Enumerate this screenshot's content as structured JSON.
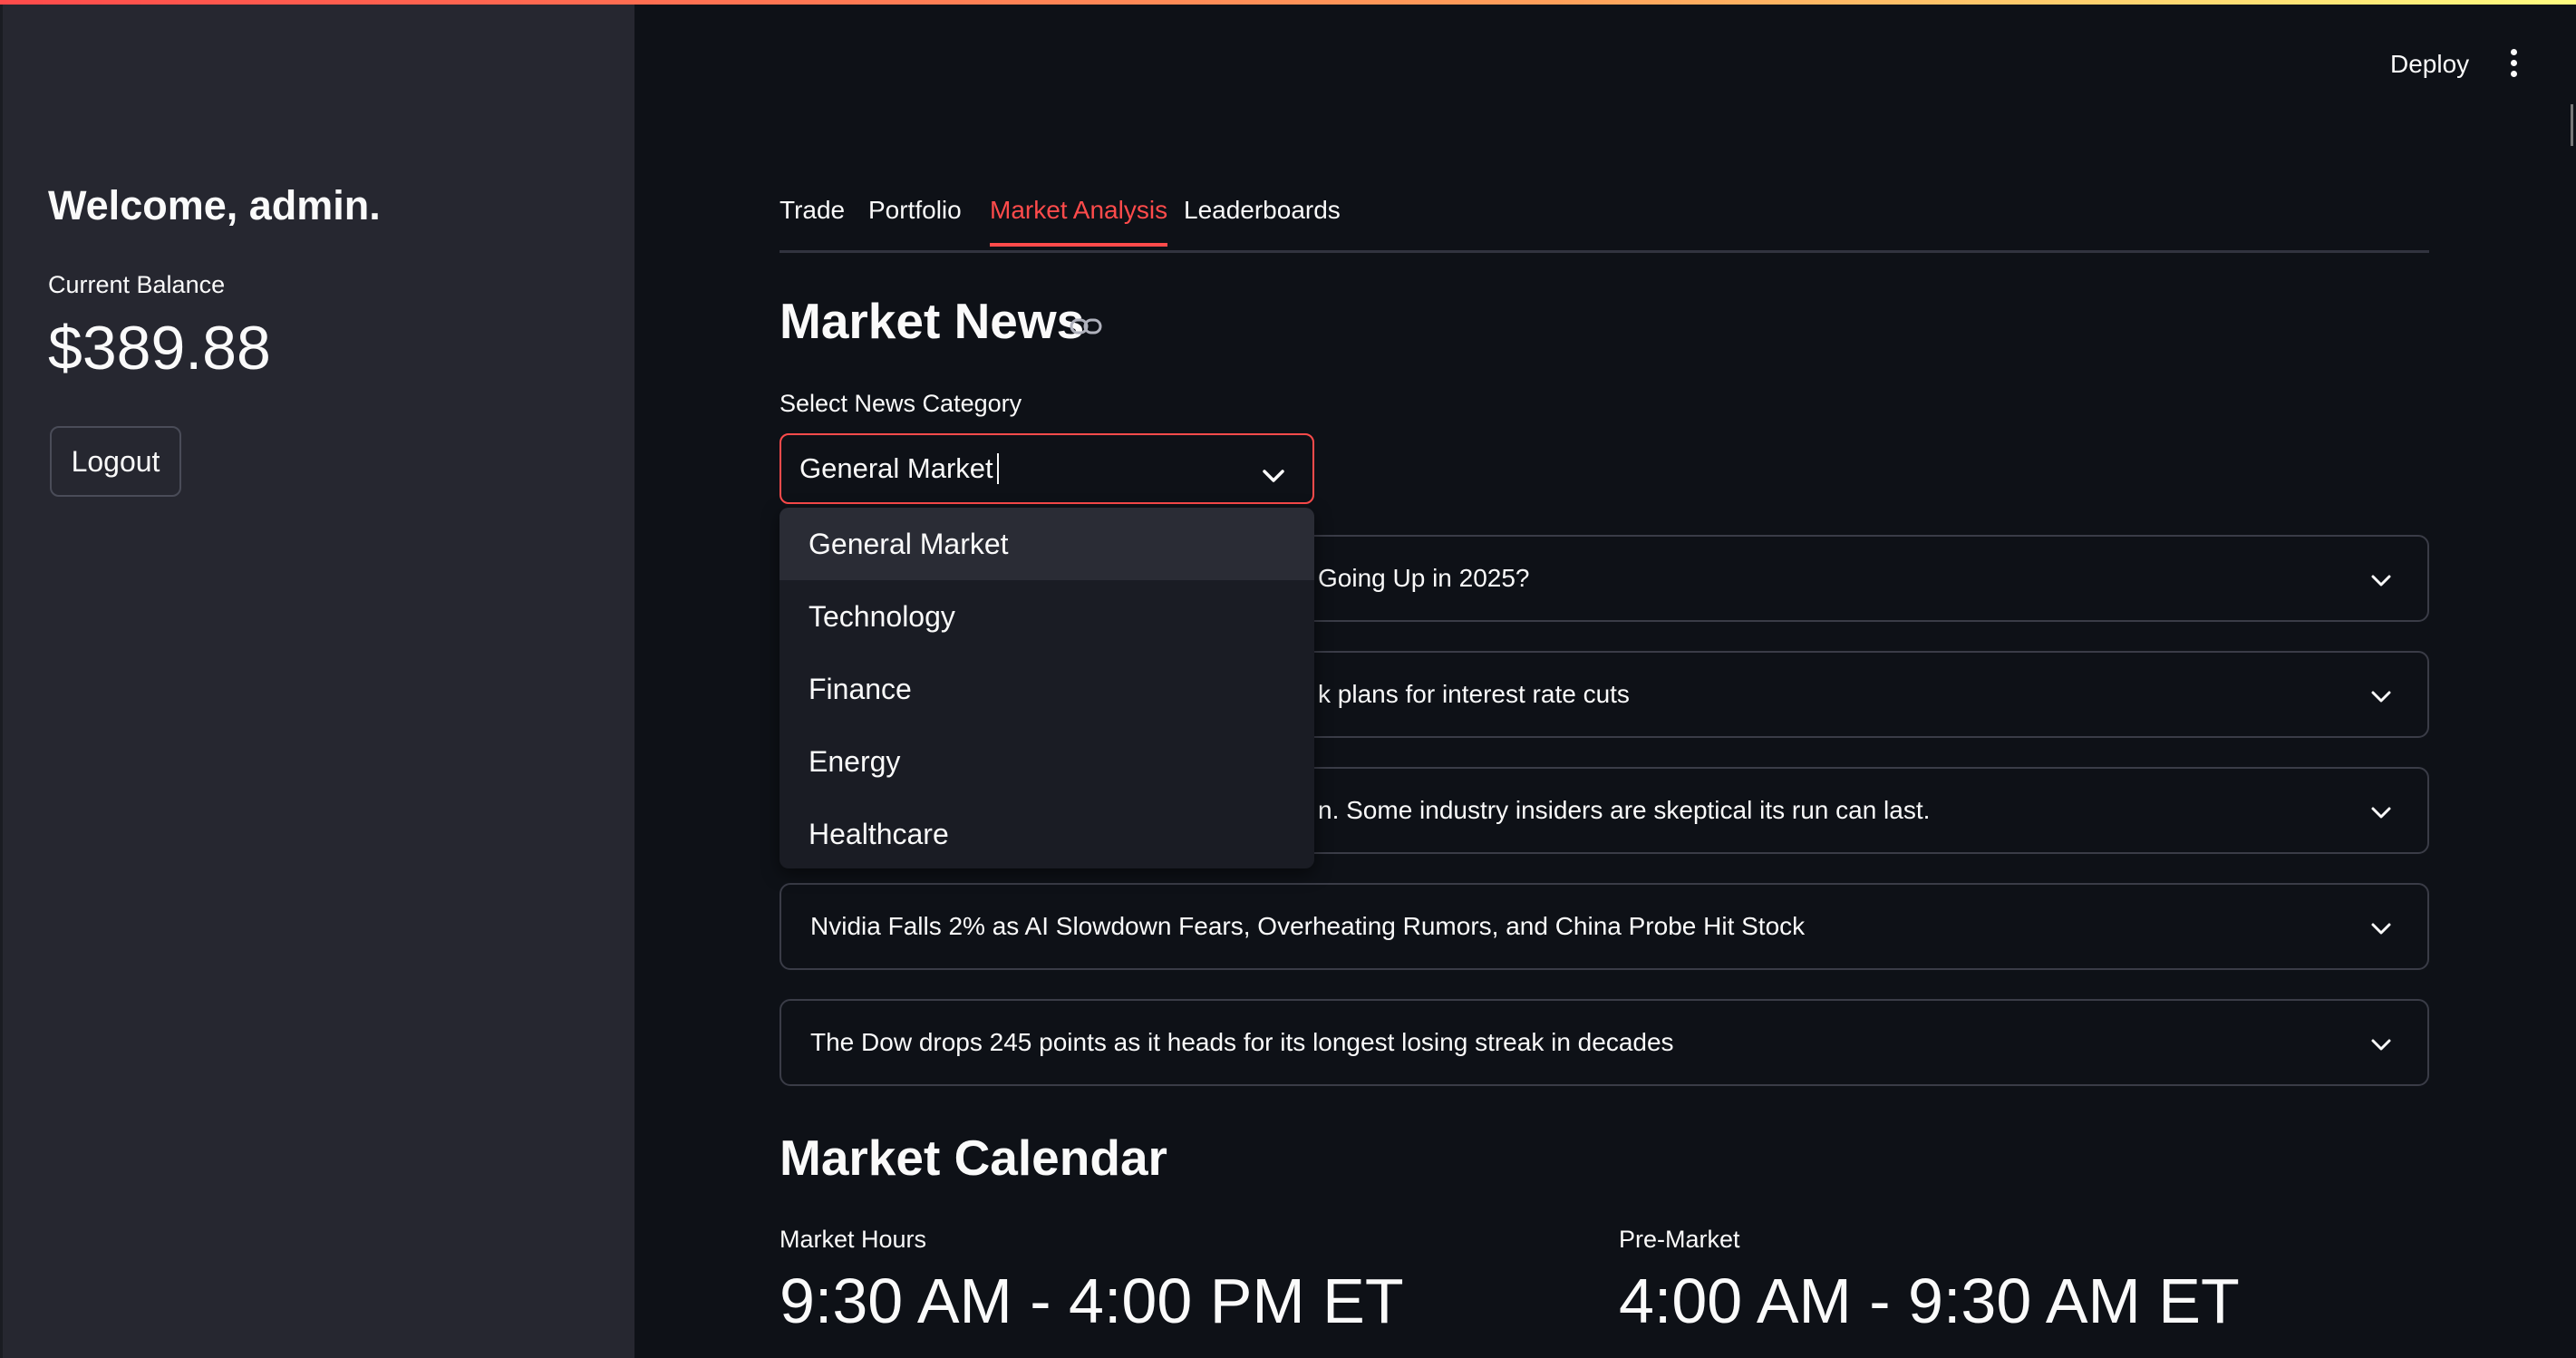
{
  "sidebar": {
    "welcome": "Welcome, admin.",
    "balance_label": "Current Balance",
    "balance_value": "$389.88",
    "logout_label": "Logout"
  },
  "header": {
    "deploy_label": "Deploy",
    "menu_icon": "kebab-menu-icon"
  },
  "tabs": [
    {
      "label": "Trade",
      "active": false
    },
    {
      "label": "Portfolio",
      "active": false
    },
    {
      "label": "Market Analysis",
      "active": true
    },
    {
      "label": "Leaderboards",
      "active": false
    }
  ],
  "news": {
    "heading": "Market News",
    "heading_icon": "link-icon",
    "select_label": "Select News Category",
    "select_value": "General Market",
    "options": [
      "General Market",
      "Technology",
      "Finance",
      "Energy",
      "Healthcare"
    ],
    "items": [
      {
        "visible_text": "Going Up in 2025?"
      },
      {
        "visible_text": "k plans for interest rate cuts"
      },
      {
        "visible_text": "n. Some industry insiders are skeptical its run can last."
      },
      {
        "visible_text": "Nvidia Falls 2% as AI Slowdown Fears, Overheating Rumors, and China Probe Hit Stock"
      },
      {
        "visible_text": "The Dow drops 245 points as it heads for its longest losing streak in decades"
      }
    ]
  },
  "calendar": {
    "heading": "Market Calendar",
    "market_hours_label": "Market Hours",
    "market_hours_value": "9:30 AM - 4:00 PM ET",
    "premarket_label": "Pre-Market",
    "premarket_value": "4:00 AM - 9:30 AM ET"
  },
  "colors": {
    "accent": "#ff4b4b",
    "background": "#0e1117",
    "sidebar": "#262730"
  }
}
